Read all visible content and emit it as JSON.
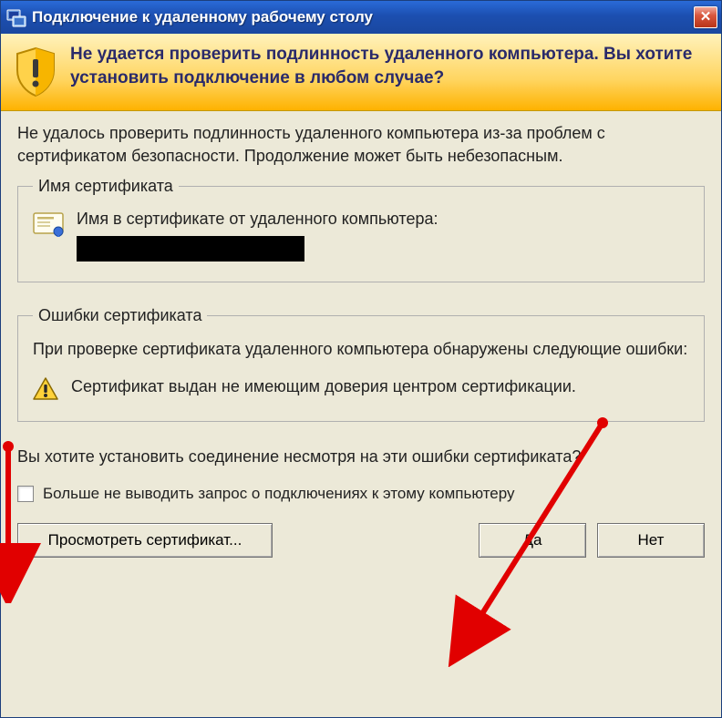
{
  "titlebar": {
    "title": "Подключение к удаленному рабочему столу",
    "close_symbol": "✕"
  },
  "banner": {
    "heading": "Не удается проверить подлинность удаленного компьютера. Вы хотите установить подключение в любом случае?"
  },
  "intro": "Не удалось проверить подлинность удаленного компьютера из-за проблем с сертификатом безопасности. Продолжение может быть небезопасным.",
  "cert_group": {
    "legend": "Имя сертификата",
    "label": "Имя в сертификате от удаленного компьютера:"
  },
  "errors_group": {
    "legend": "Ошибки сертификата",
    "intro": "При проверке сертификата удаленного компьютера обнаружены следующие ошибки:",
    "item": "Сертификат выдан не имеющим доверия центром сертификации."
  },
  "question": "Вы хотите установить соединение несмотря на эти ошибки сертификата?",
  "checkbox": {
    "label": "Больше не выводить запрос о подключениях к этому компьютеру"
  },
  "buttons": {
    "view_cert": "Просмотреть сертификат...",
    "yes": "Да",
    "no": "Нет"
  }
}
